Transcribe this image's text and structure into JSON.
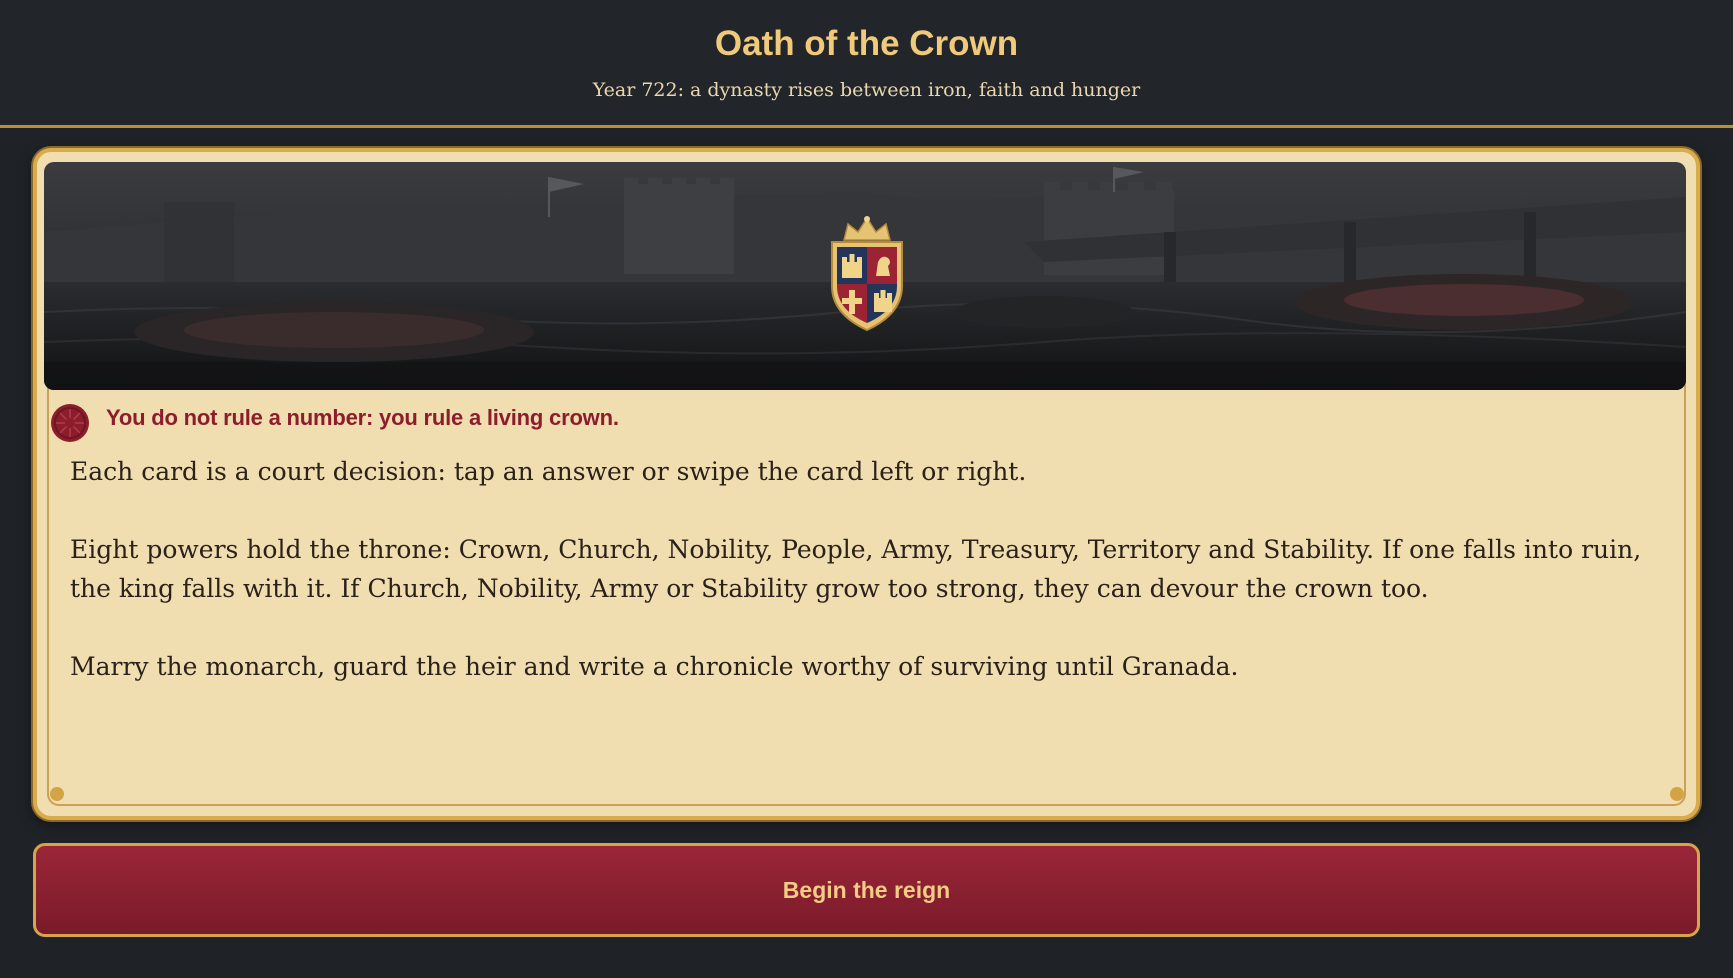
{
  "header": {
    "title": "Oath of the Crown",
    "subtitle": "Year 722: a dynasty rises between iron, faith and hunger"
  },
  "card": {
    "banner_scene": "castle-harbor-scene",
    "crest_icon": "royal-crest-icon",
    "motto_icon": "crown-seal-icon",
    "motto": "You do not rule a number: you rule a living crown.",
    "paragraphs": [
      "Each card is a court decision: tap an answer or swipe the card left or right.",
      "Eight powers hold the throne: Crown, Church, Nobility, People, Army, Treasury, Territory and Stability. If one falls into ruin, the king falls with it. If Church, Nobility, Army or Stability grow too strong, they can devour the crown too.",
      "Marry the monarch, guard the heir and write a chronicle worthy of surviving until Granada."
    ]
  },
  "actions": {
    "begin_label": "Begin the reign"
  },
  "colors": {
    "background": "#1f2327",
    "gold": "#f0c97b",
    "parchment": "#f1deb0",
    "crimson": "#8c1e2c"
  }
}
